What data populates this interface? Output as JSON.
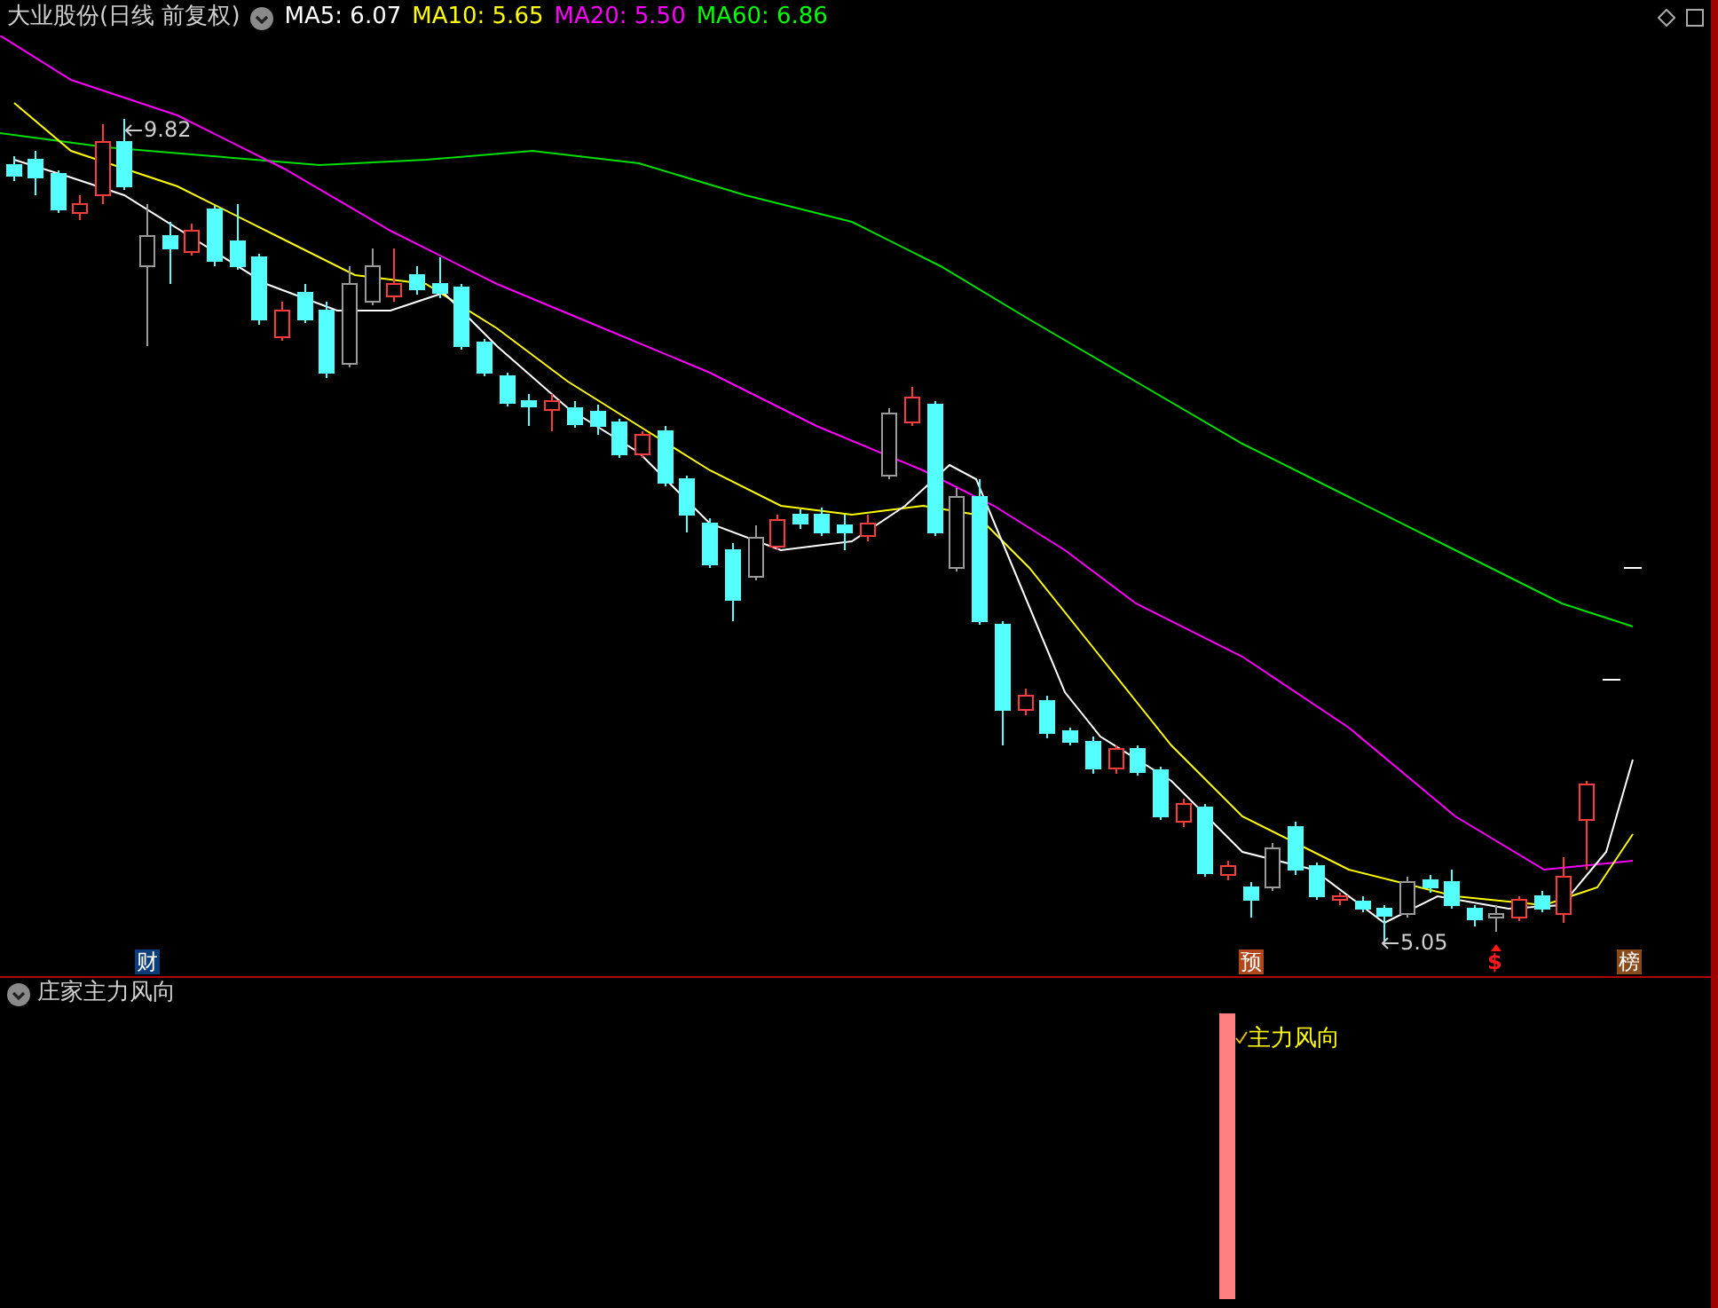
{
  "header": {
    "title": "大业股份(日线 前复权)",
    "indicators": [
      {
        "label": "MA5: 6.07",
        "color": "#ffffff"
      },
      {
        "label": "MA10: 5.65",
        "color": "#ffff00"
      },
      {
        "label": "MA20: 5.50",
        "color": "#ff00ff"
      },
      {
        "label": "MA60: 6.86",
        "color": "#00ff00"
      }
    ]
  },
  "price_labels": [
    {
      "text": "9.82"
    },
    {
      "text": "5.05"
    }
  ],
  "markers": [
    {
      "text": "财",
      "kind": "badge",
      "color": "#0b3d7a"
    },
    {
      "text": "预",
      "kind": "badge",
      "color": "#b2471b"
    },
    {
      "text": "$",
      "kind": "symbol",
      "color": "#ff1a1a"
    },
    {
      "text": "榜",
      "kind": "badge",
      "color": "#8a4b1c"
    }
  ],
  "lower_panel": {
    "title": "庄家主力风向",
    "signal_label": "主力风向"
  }
}
